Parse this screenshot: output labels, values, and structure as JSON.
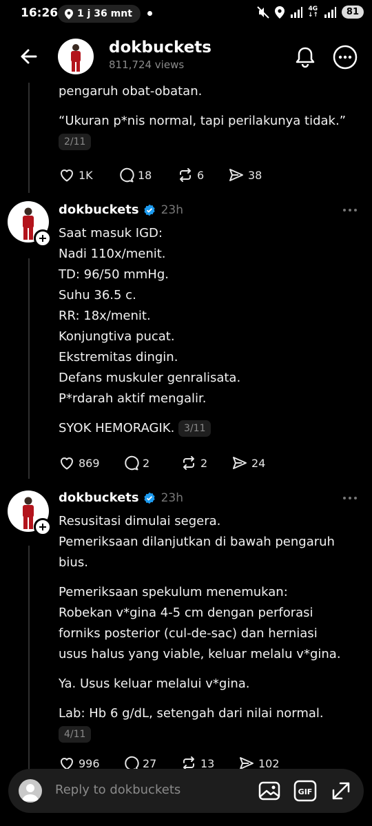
{
  "status_bar": {
    "time": "16:26",
    "pill_text": "1 j 36 mnt",
    "network": "4G",
    "battery": "81"
  },
  "header": {
    "username": "dokbuckets",
    "views": "811,724 views"
  },
  "post2": {
    "lines": [
      "pengaruh obat-obatan.",
      "“Ukuran p*nis normal, tapi perilakunya tidak.”"
    ],
    "counter": "2/11",
    "likes": "1K",
    "replies": "18",
    "reposts": "6",
    "shares": "38"
  },
  "post3": {
    "username": "dokbuckets",
    "time": "23h",
    "lines": [
      "Saat masuk IGD:",
      "Nadi 110x/menit.",
      "TD: 96/50 mmHg.",
      "Suhu 36.5 c.",
      "RR: 18x/menit.",
      "Konjungtiva pucat.",
      "Ekstremitas dingin.",
      "Defans muskuler genralisata.",
      "P*rdarah aktif mengalir."
    ],
    "final_line": "SYOK HEMORAGIK.",
    "counter": "3/11",
    "likes": "869",
    "replies": "2",
    "reposts": "2",
    "shares": "24"
  },
  "post4": {
    "username": "dokbuckets",
    "time": "23h",
    "para1": [
      "Resusitasi dimulai segera.",
      "Pemeriksaan dilanjutkan di bawah pengaruh",
      "bius."
    ],
    "para2": [
      "Pemeriksaan spekulum menemukan:",
      "Robekan v*gina 4-5 cm dengan perforasi",
      "forniks posterior (cul-de-sac) dan herniasi",
      "usus halus yang viable, keluar melalu v*gina."
    ],
    "para3": "Ya. Usus keluar melalui v*gina.",
    "para4": "Lab: Hb 6 g/dL, setengah dari nilai normal.",
    "counter": "4/11",
    "likes": "996",
    "replies": "27",
    "reposts": "13",
    "shares": "102"
  },
  "reply_bar": {
    "placeholder": "Reply to dokbuckets"
  },
  "icons": {
    "back": "arrow-left-icon",
    "notify": "bell-icon",
    "more": "more-circle-icon",
    "like": "heart-icon",
    "reply": "comment-icon",
    "repost": "repost-icon",
    "share": "send-icon",
    "verified": "verified-badge-icon",
    "image": "image-icon",
    "gif": "gif-icon",
    "expand": "expand-icon"
  },
  "colors": {
    "background": "#000000",
    "verified": "#1d9bf0",
    "muted": "#777777",
    "outfit": "#b3141c"
  }
}
